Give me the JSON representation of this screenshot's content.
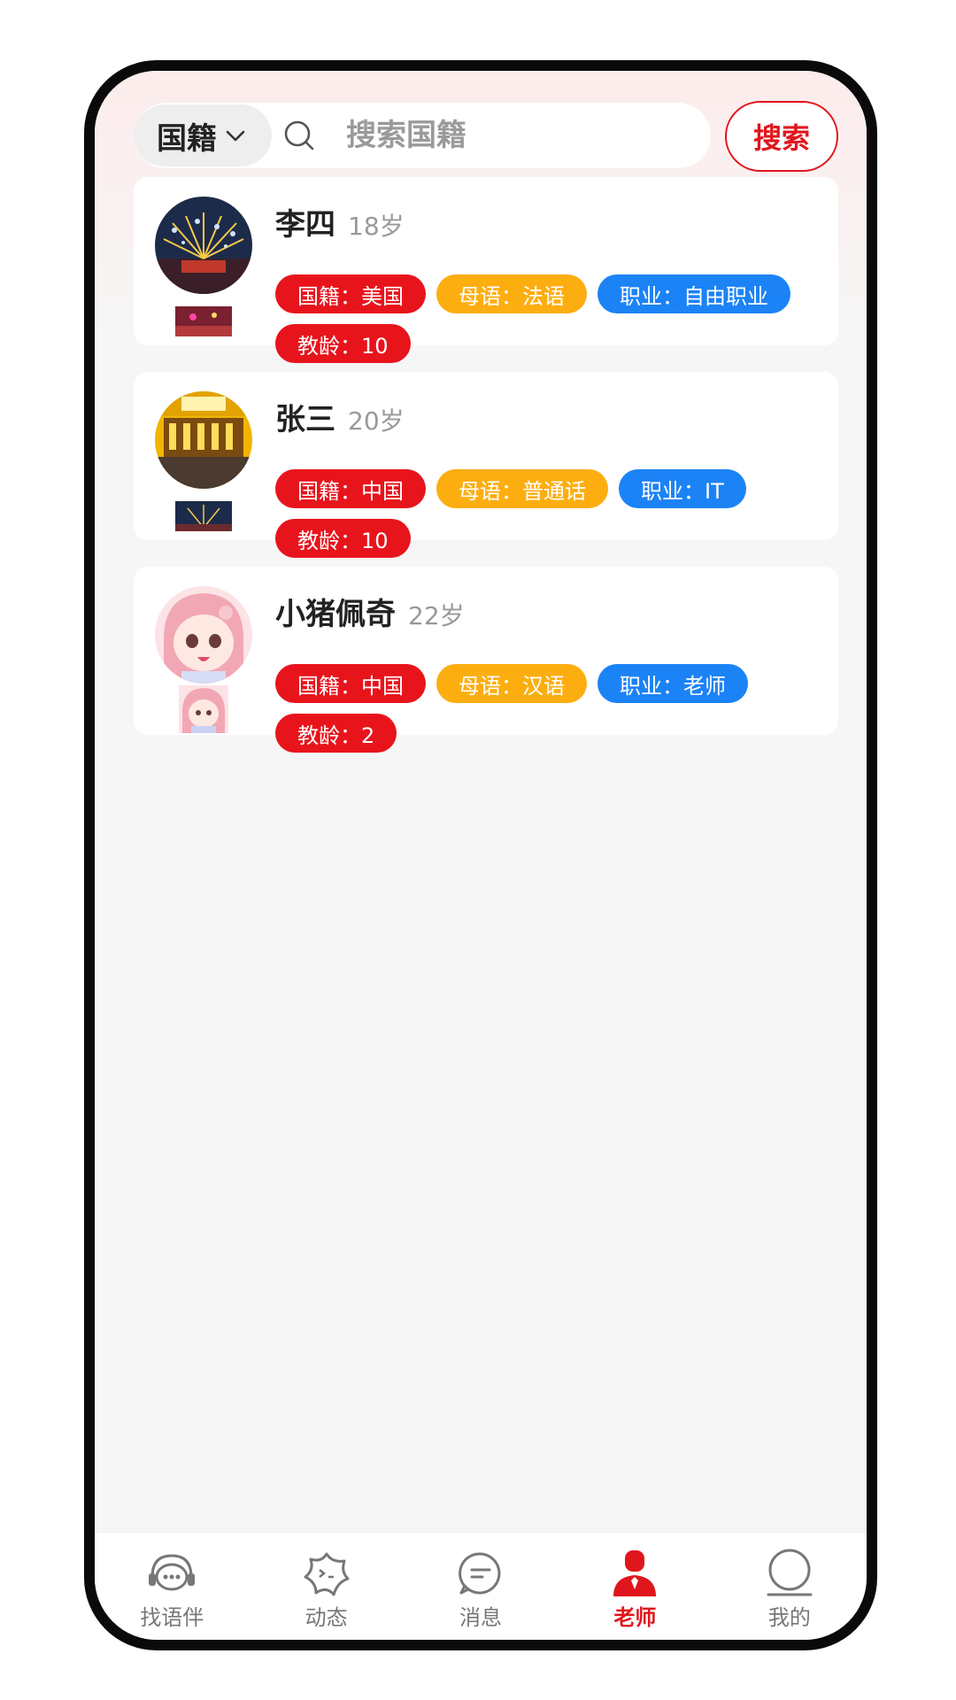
{
  "search": {
    "nationality_label": "国籍",
    "placeholder": "搜索国籍",
    "button_label": "搜索"
  },
  "teachers": [
    {
      "name": "李四",
      "age": "18岁",
      "tags": [
        {
          "text": "国籍：美国",
          "color": "#e8141c"
        },
        {
          "text": "母语：法语",
          "color": "#fcae11"
        },
        {
          "text": "职业：自由职业",
          "color": "#1c83f6"
        },
        {
          "text": "教龄：10",
          "color": "#e8141c"
        }
      ]
    },
    {
      "name": "张三",
      "age": "20岁",
      "tags": [
        {
          "text": "国籍：中国",
          "color": "#e8141c"
        },
        {
          "text": "母语：普通话",
          "color": "#fcae11"
        },
        {
          "text": "职业：IT",
          "color": "#1c83f6"
        },
        {
          "text": "教龄：10",
          "color": "#e8141c"
        }
      ]
    },
    {
      "name": "小猪佩奇",
      "age": "22岁",
      "tags": [
        {
          "text": "国籍：中国",
          "color": "#e8141c"
        },
        {
          "text": "母语：汉语",
          "color": "#fcae11"
        },
        {
          "text": "职业：老师",
          "color": "#1c83f6"
        },
        {
          "text": "教龄：2",
          "color": "#e8141c"
        }
      ]
    }
  ],
  "nav": {
    "items": [
      {
        "label": "找语伴",
        "icon": "headset-chat-icon"
      },
      {
        "label": "动态",
        "icon": "star-face-icon"
      },
      {
        "label": "消息",
        "icon": "message-bubble-icon"
      },
      {
        "label": "老师",
        "icon": "teacher-icon"
      },
      {
        "label": "我的",
        "icon": "user-profile-icon"
      }
    ],
    "active": "老师"
  },
  "colors": {
    "accent": "#e0161d",
    "tag_red": "#e8141c",
    "tag_orange": "#fcae11",
    "tag_blue": "#1c83f6"
  }
}
